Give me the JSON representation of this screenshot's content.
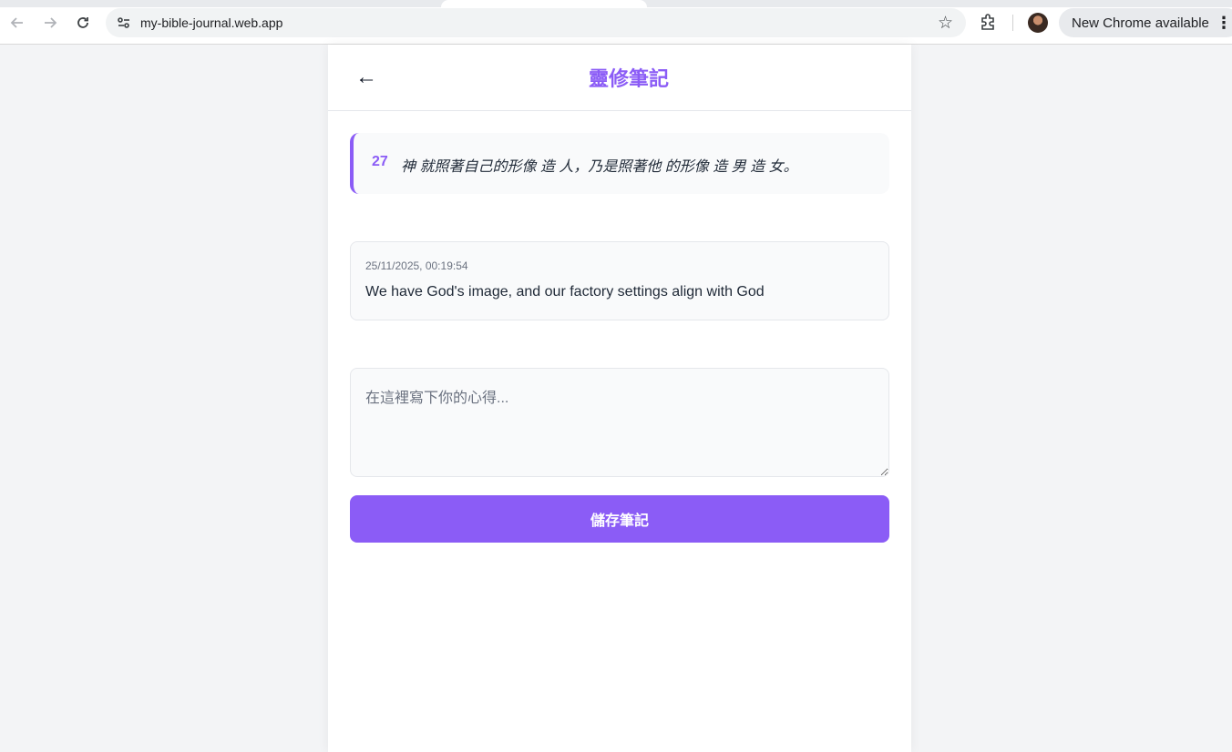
{
  "browser": {
    "url": "my-bible-journal.web.app",
    "update_label": "New Chrome available"
  },
  "header": {
    "back_glyph": "←",
    "title": "靈修筆記"
  },
  "verse": {
    "number": "27",
    "text": "神 就照著自己的形像 造 人，乃是照著他 的形像 造 男 造 女。"
  },
  "notes": [
    {
      "timestamp": "25/11/2025, 00:19:54",
      "text": "We have God's image, and our factory settings align with God"
    }
  ],
  "composer": {
    "placeholder": "在這裡寫下你的心得...",
    "value": "",
    "save_label": "儲存筆記"
  },
  "colors": {
    "accent": "#8b5cf6",
    "card_bg": "#f9fafb",
    "page_bg": "#f3f4f6"
  }
}
